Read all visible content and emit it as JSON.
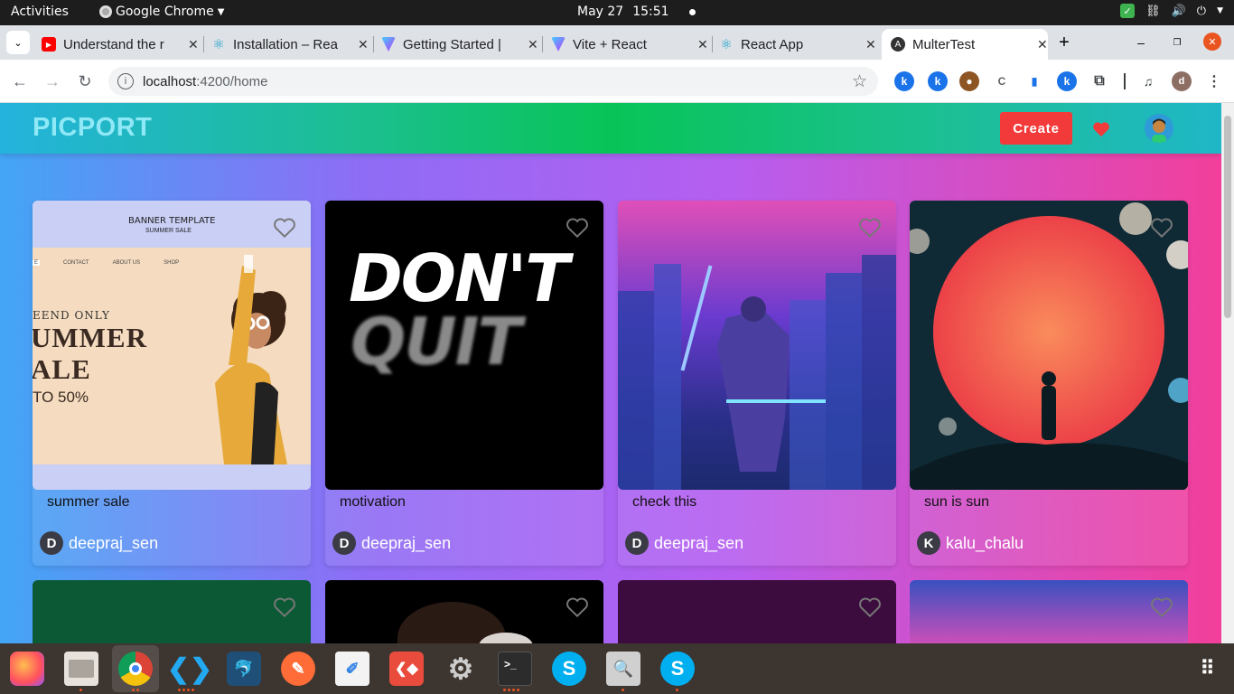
{
  "system_bar": {
    "activities": "Activities",
    "app_name": "Google Chrome",
    "date": "May 27",
    "time": "15:51"
  },
  "tabs": [
    {
      "title": "Understand the r",
      "icon": "youtube-icon"
    },
    {
      "title": "Installation – Rea",
      "icon": "react-icon"
    },
    {
      "title": "Getting Started |",
      "icon": "vite-icon"
    },
    {
      "title": "Vite + React",
      "icon": "vite-icon"
    },
    {
      "title": "React App",
      "icon": "react-icon"
    },
    {
      "title": "MulterTest",
      "icon": "angular-icon",
      "active": true
    }
  ],
  "address_bar": {
    "host": "localhost",
    "path": ":4200/home"
  },
  "app": {
    "logo": "PICPORT",
    "create_label": "Create"
  },
  "posts": [
    {
      "caption": "summer sale",
      "user": "deepraj_sen",
      "initial": "D",
      "image_text": {
        "title": "BANNER TEMPLATE",
        "subtitle": "SUMMER SALE",
        "menu": [
          "E",
          "CONTACT",
          "ABOUT US",
          "SHOP"
        ],
        "line1": "EEND ONLY",
        "line2": "UMMER",
        "line3": "ALE",
        "line4": "TO 50%"
      }
    },
    {
      "caption": "motivation",
      "user": "deepraj_sen",
      "initial": "D",
      "image_text": {
        "line1": "DON'T",
        "line2": "QUIT"
      }
    },
    {
      "caption": "check this",
      "user": "deepraj_sen",
      "initial": "D"
    },
    {
      "caption": "sun is sun",
      "user": "kalu_chalu",
      "initial": "K"
    }
  ],
  "colors": {
    "accent_red": "#f33a3a",
    "nav_green": "#08c457",
    "gradient_left": "#43a5f5",
    "gradient_right": "#f23f9b"
  },
  "dock": [
    "firefox-icon",
    "files-icon",
    "chrome-icon",
    "vscode-icon",
    "mysql-workbench-icon",
    "postman-icon",
    "text-editor-icon",
    "git-icon",
    "settings-icon",
    "terminal-icon",
    "skype-icon",
    "image-viewer-icon",
    "skype-icon",
    "app-grid-icon"
  ]
}
